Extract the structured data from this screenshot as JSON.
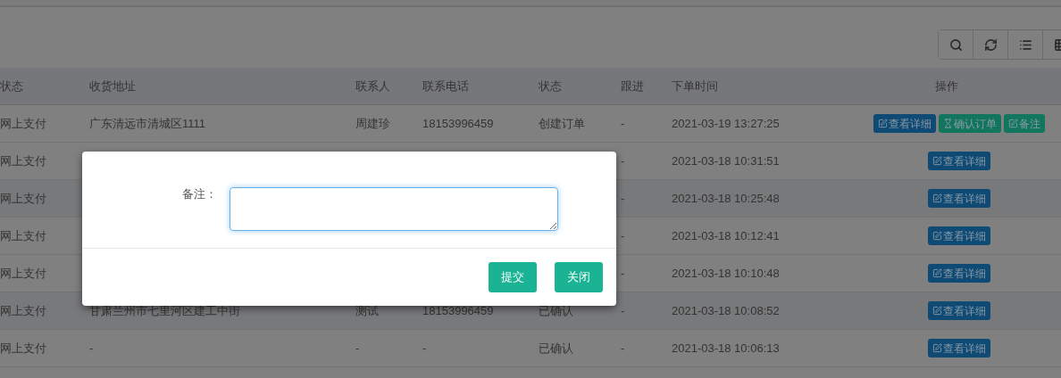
{
  "toolbar": [
    {
      "kind": "search"
    },
    {
      "kind": "refresh"
    },
    {
      "kind": "list"
    },
    {
      "kind": "grid"
    }
  ],
  "table": {
    "columns": [
      "状态",
      "收货地址",
      "联系人",
      "联系电话",
      "状态",
      "跟进",
      "下单时间",
      "操作"
    ],
    "rows": [
      {
        "payment": "网上支付",
        "address": "广东清远市清城区1111",
        "contact": "周建珍",
        "phone": "18153996459",
        "status": "创建订单",
        "follow": "-",
        "time": "2021-03-19 13:27:25",
        "actions": [
          {
            "kind": "view",
            "label": "查看详细"
          },
          {
            "kind": "confirm",
            "label": "确认订单"
          },
          {
            "kind": "note",
            "label": "备注"
          }
        ]
      },
      {
        "payment": "网上支付",
        "follow": "-",
        "time": "2021-03-18 10:31:51",
        "actions": [
          {
            "kind": "view",
            "label": "查看详细"
          }
        ]
      },
      {
        "payment": "网上支付",
        "follow": "-",
        "time": "2021-03-18 10:25:48",
        "actions": [
          {
            "kind": "view",
            "label": "查看详细"
          }
        ]
      },
      {
        "payment": "网上支付",
        "follow": "-",
        "time": "2021-03-18 10:12:41",
        "actions": [
          {
            "kind": "view",
            "label": "查看详细"
          }
        ]
      },
      {
        "payment": "网上支付",
        "follow": "-",
        "time": "2021-03-18 10:10:48",
        "actions": [
          {
            "kind": "view",
            "label": "查看详细"
          }
        ]
      },
      {
        "payment": "网上支付",
        "address": "甘肃兰州市七里河区建工中街",
        "contact": "测试",
        "phone": "18153996459",
        "status": "已确认",
        "follow": "-",
        "time": "2021-03-18 10:08:52",
        "actions": [
          {
            "kind": "view",
            "label": "查看详细"
          }
        ]
      },
      {
        "payment": "网上支付",
        "address": "-",
        "contact": "-",
        "phone": "-",
        "status": "已确认",
        "follow": "-",
        "time": "2021-03-18 10:06:13",
        "actions": [
          {
            "kind": "view",
            "label": "查看详细"
          }
        ]
      }
    ]
  },
  "dialog": {
    "label": "备注：",
    "buttons": [
      "提交",
      "关闭"
    ]
  }
}
